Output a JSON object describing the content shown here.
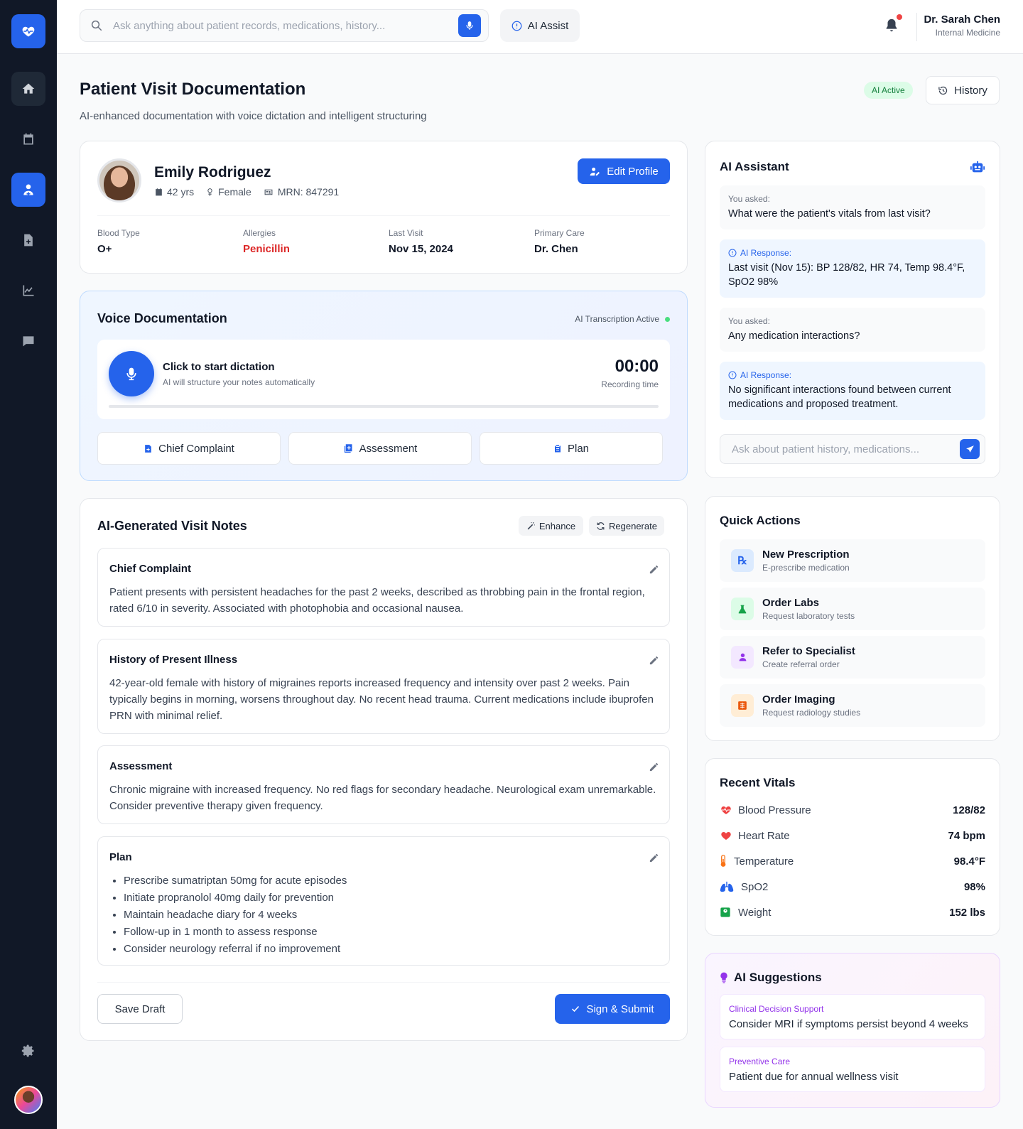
{
  "search": {
    "placeholder": "Ask anything about patient records, medications, history...",
    "value": ""
  },
  "topbar": {
    "ai_assist_label": "AI Assist",
    "user_name": "Dr. Sarah Chen",
    "user_role": "Internal Medicine"
  },
  "header": {
    "title": "Patient Visit Documentation",
    "subtitle": "AI-enhanced documentation with voice dictation and intelligent structuring",
    "status_badge": "AI Active",
    "history_label": "History"
  },
  "patient": {
    "name": "Emily Rodriguez",
    "age": "42 yrs",
    "gender": "Female",
    "mrn": "MRN: 847291",
    "edit_label": "Edit Profile",
    "stats": [
      {
        "label": "Blood Type",
        "value": "O+"
      },
      {
        "label": "Allergies",
        "value": "Penicillin"
      },
      {
        "label": "Last Visit",
        "value": "Nov 15, 2024"
      },
      {
        "label": "Primary Care",
        "value": "Dr. Chen"
      }
    ]
  },
  "voice": {
    "title": "Voice Documentation",
    "status": "AI Transcription Active",
    "prompt": "Click to start dictation",
    "hint": "AI will structure your notes automatically",
    "timer": "00:00",
    "timer_label": "Recording time",
    "progress": 0,
    "sections": [
      "Chief Complaint",
      "Assessment",
      "Plan"
    ]
  },
  "notes": {
    "title": "AI-Generated Visit Notes",
    "enhance_label": "Enhance",
    "regenerate_label": "Regenerate",
    "chief_complaint": {
      "title": "Chief Complaint",
      "text": "Patient presents with persistent headaches for the past 2 weeks, described as throbbing pain in the frontal region, rated 6/10 in severity. Associated with photophobia and occasional nausea."
    },
    "hpi": {
      "title": "History of Present Illness",
      "text": "42-year-old female with history of migraines reports increased frequency and intensity over past 2 weeks. Pain typically begins in morning, worsens throughout day. No recent head trauma. Current medications include ibuprofen PRN with minimal relief."
    },
    "assessment": {
      "title": "Assessment",
      "text": "Chronic migraine with increased frequency. No red flags for secondary headache. Neurological exam unremarkable. Consider preventive therapy given frequency."
    },
    "plan": {
      "title": "Plan",
      "items": [
        "Prescribe sumatriptan 50mg for acute episodes",
        "Initiate propranolol 40mg daily for prevention",
        "Maintain headache diary for 4 weeks",
        "Follow-up in 1 month to assess response",
        "Consider neurology referral if no improvement"
      ]
    },
    "save_label": "Save Draft",
    "submit_label": "Sign & Submit"
  },
  "assistant": {
    "title": "AI Assistant",
    "messages": [
      {
        "label": "You asked:",
        "text": "What were the patient's vitals from last visit?"
      },
      {
        "label": "AI Response:",
        "text": "Last visit (Nov 15): BP 128/82, HR 74, Temp 98.4°F, SpO2 98%"
      },
      {
        "label": "You asked:",
        "text": "Any medication interactions?"
      },
      {
        "label": "AI Response:",
        "text": "No significant interactions found between current medications and proposed treatment."
      }
    ],
    "input_placeholder": "Ask about patient history, medications..."
  },
  "quick_actions": {
    "title": "Quick Actions",
    "items": [
      {
        "label": "New Prescription",
        "sub": "E-prescribe medication",
        "icon": "prescription-icon",
        "color": "#2563eb"
      },
      {
        "label": "Order Labs",
        "sub": "Request laboratory tests",
        "icon": "flask-icon",
        "color": "#16a34a"
      },
      {
        "label": "Refer to Specialist",
        "sub": "Create referral order",
        "icon": "doctor-icon",
        "color": "#9333ea"
      },
      {
        "label": "Order Imaging",
        "sub": "Request radiology studies",
        "icon": "x-ray-icon",
        "color": "#ea580c"
      }
    ]
  },
  "vitals": {
    "title": "Recent Vitals",
    "items": [
      {
        "label": "Blood Pressure",
        "value": "128/82",
        "icon": "heart-pulse-icon"
      },
      {
        "label": "Heart Rate",
        "value": "74 bpm",
        "icon": "heart-icon"
      },
      {
        "label": "Temperature",
        "value": "98.4°F",
        "icon": "thermometer-icon"
      },
      {
        "label": "SpO2",
        "value": "98%",
        "icon": "lungs-icon"
      },
      {
        "label": "Weight",
        "value": "152 lbs",
        "icon": "weight-icon"
      }
    ]
  },
  "suggestions": {
    "title": "AI Suggestions",
    "items": [
      {
        "type": "Clinical Decision Support",
        "text": "Consider MRI if symptoms persist beyond 4 weeks"
      },
      {
        "type": "Preventive Care",
        "text": "Patient due for annual wellness visit"
      }
    ]
  }
}
